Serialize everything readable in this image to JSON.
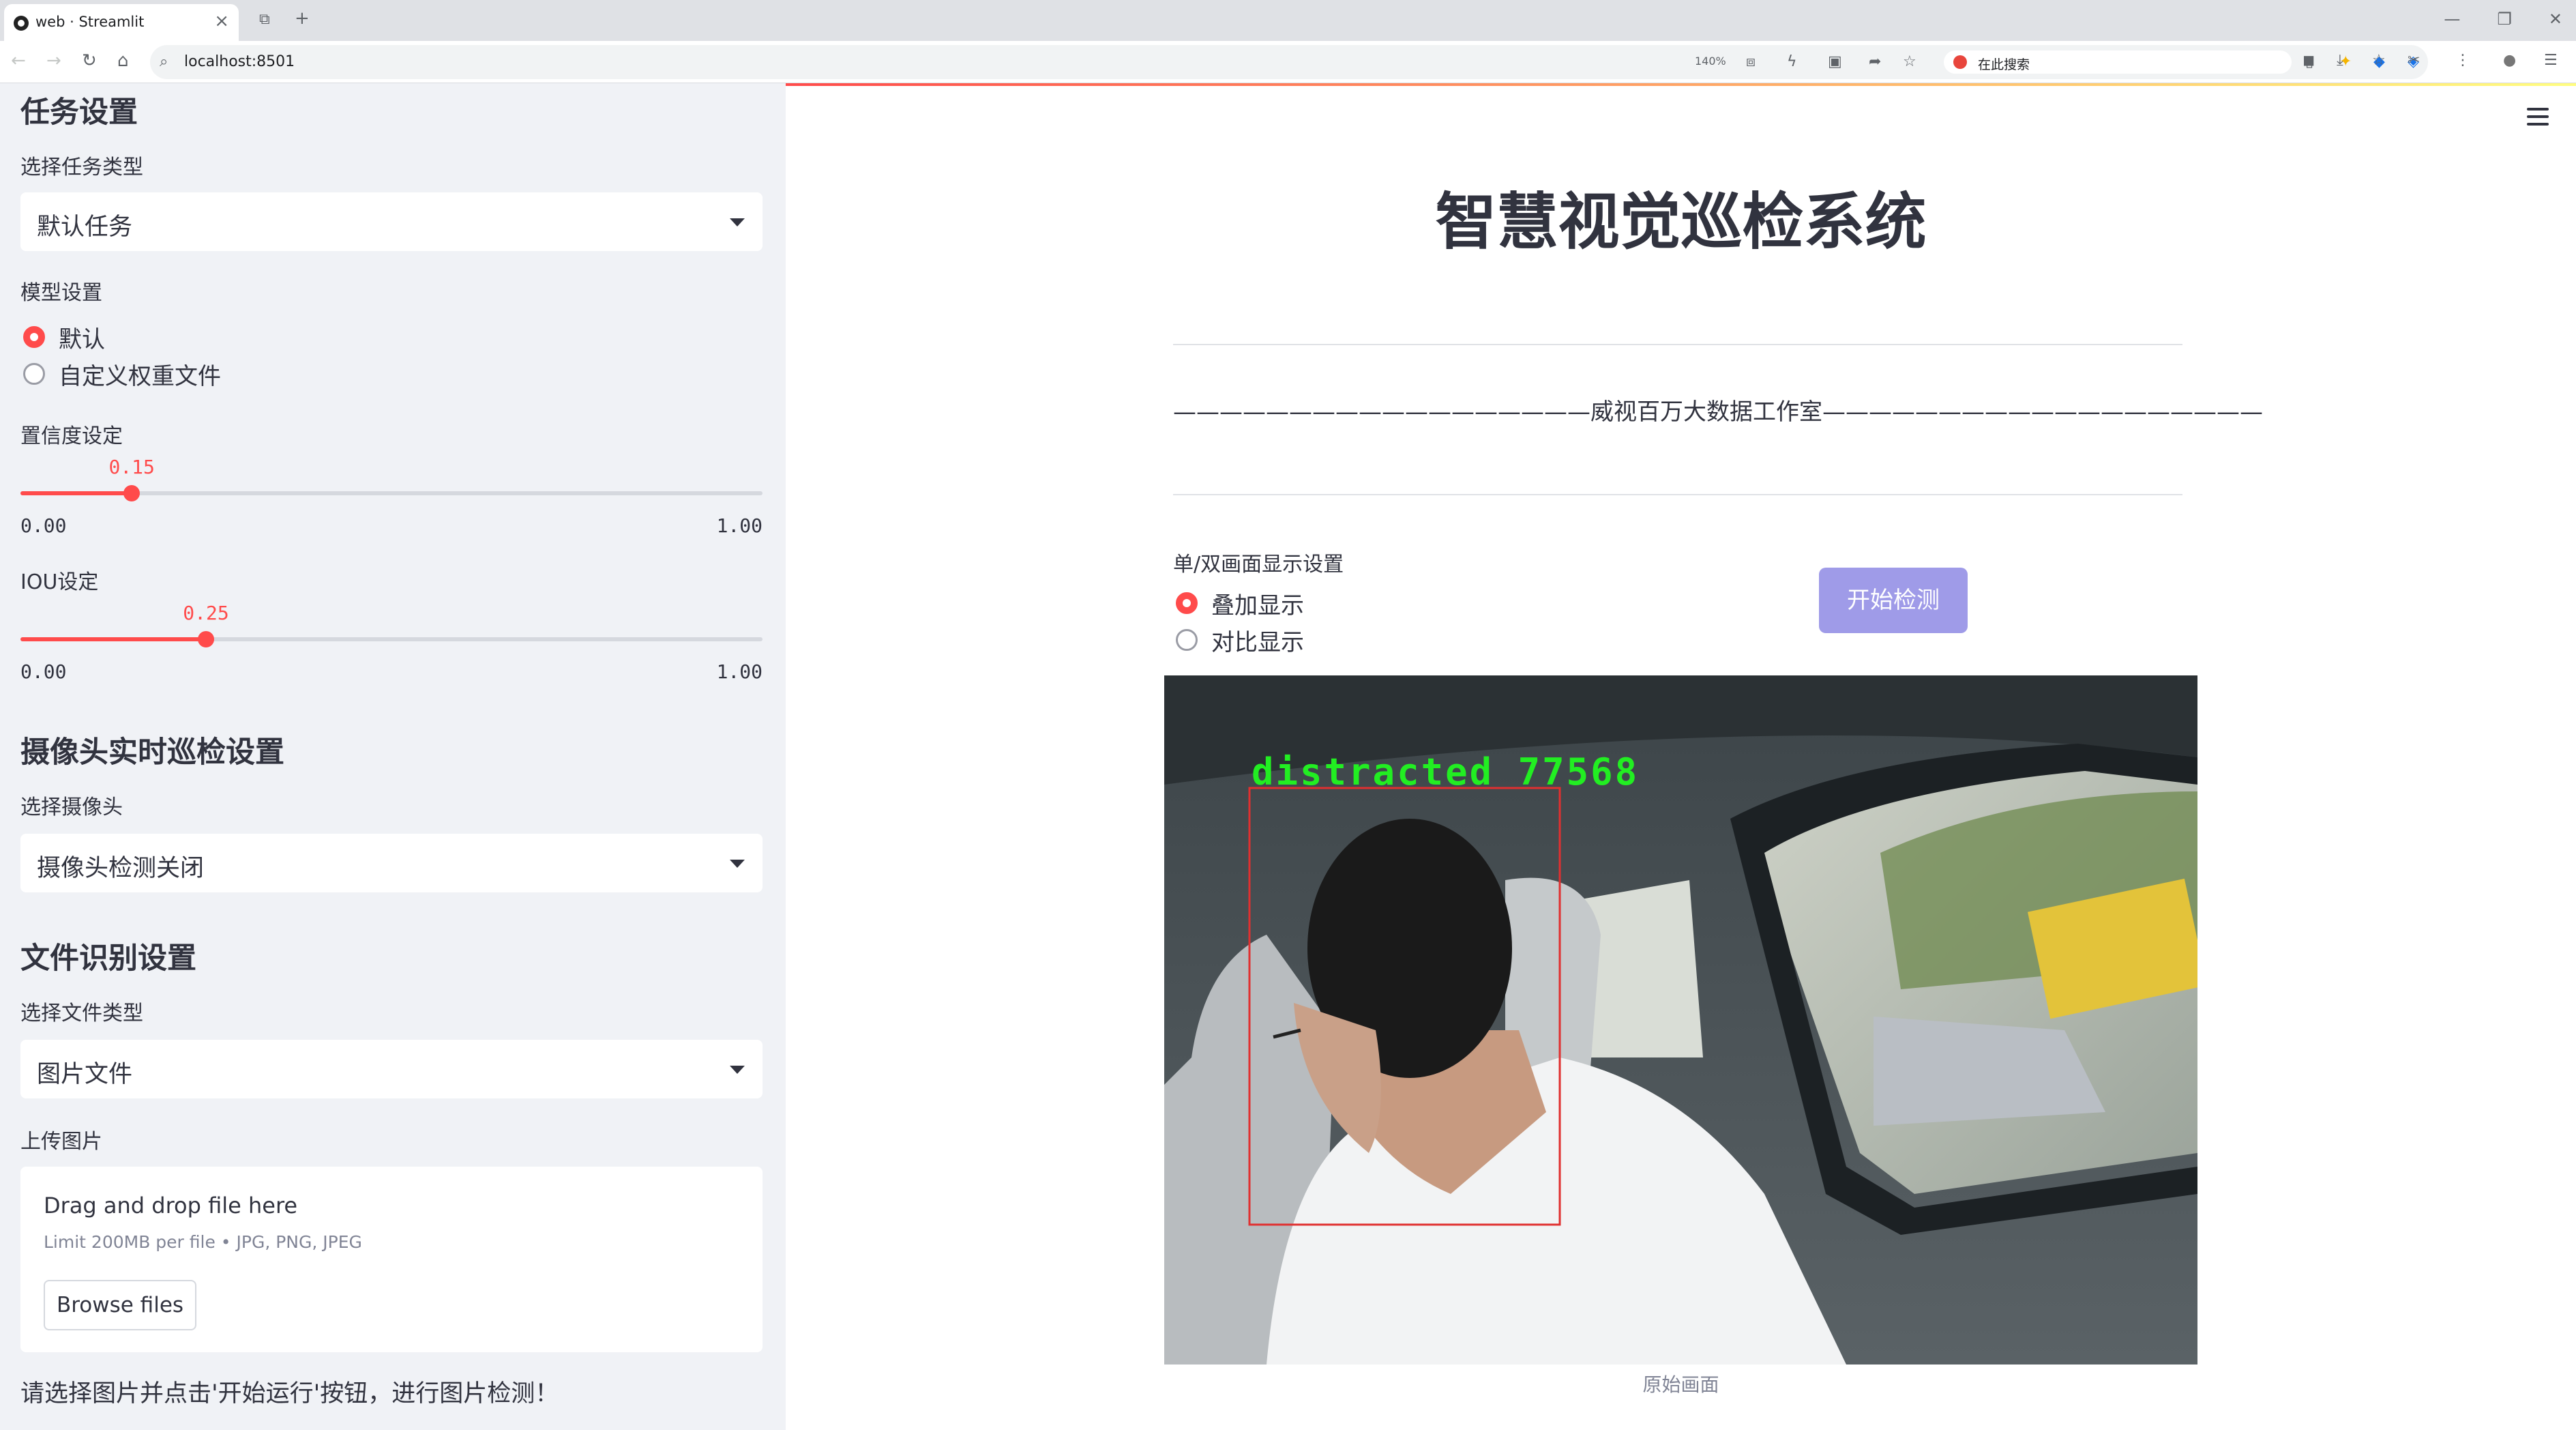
{
  "browser": {
    "tab_title": "web · Streamlit",
    "url": "localhost:8501",
    "zoom": "140%",
    "search_placeholder": "在此搜索"
  },
  "sidebar": {
    "task_section": "任务设置",
    "task_type_label": "选择任务类型",
    "task_type_value": "默认任务",
    "model_label": "模型设置",
    "model_options": [
      "默认",
      "自定义权重文件"
    ],
    "model_selected": 0,
    "conf_label": "置信度设定",
    "conf": {
      "value": 0.15,
      "value_text": "0.15",
      "min": "0.00",
      "max": "1.00"
    },
    "iou_label": "IOU设定",
    "iou": {
      "value": 0.25,
      "value_text": "0.25",
      "min": "0.00",
      "max": "1.00"
    },
    "camera_section": "摄像头实时巡检设置",
    "camera_label": "选择摄像头",
    "camera_value": "摄像头检测关闭",
    "file_section": "文件识别设置",
    "file_type_label": "选择文件类型",
    "file_type_value": "图片文件",
    "upload_label": "上传图片",
    "upload_drag": "Drag and drop file here",
    "upload_limit": "Limit 200MB per file • JPG, PNG, JPEG",
    "browse_button": "Browse files",
    "hint": "请选择图片并点击'开始运行'按钮，进行图片检测！"
  },
  "main": {
    "title": "智慧视觉巡检系统",
    "credit": "——————————————————威视百万大数据工作室———————————————————",
    "display_label": "单/双画面显示设置",
    "display_options": [
      "叠加显示",
      "对比显示"
    ],
    "display_selected": 0,
    "start_button": "开始检测",
    "detection_label": "distracted  77568",
    "caption": "原始画面"
  }
}
